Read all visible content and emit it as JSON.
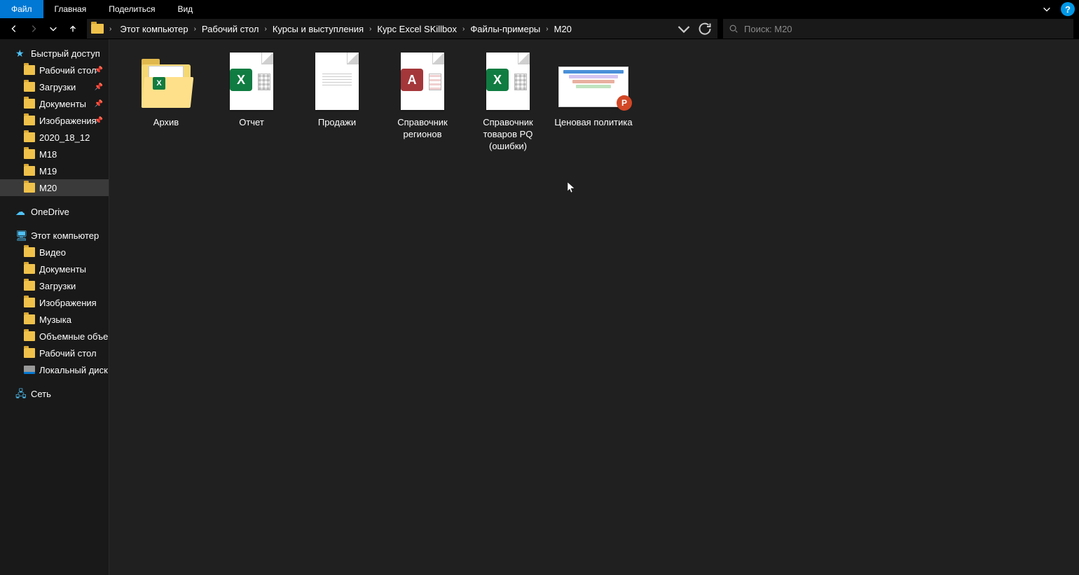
{
  "ribbon": {
    "tabs": [
      "Файл",
      "Главная",
      "Поделиться",
      "Вид"
    ],
    "active": 0,
    "help": "?"
  },
  "breadcrumb": [
    "Этот компьютер",
    "Рабочий стол",
    "Курсы и выступления",
    "Курс Excel SKillbox",
    "Файлы-примеры",
    "M20"
  ],
  "search_placeholder": "Поиск: M20",
  "sidebar": {
    "quick_access": "Быстрый доступ",
    "quick_items": [
      {
        "label": "Рабочий стол",
        "pinned": true
      },
      {
        "label": "Загрузки",
        "pinned": true
      },
      {
        "label": "Документы",
        "pinned": true
      },
      {
        "label": "Изображения",
        "pinned": true
      },
      {
        "label": "2020_18_12",
        "pinned": false
      },
      {
        "label": "M18",
        "pinned": false
      },
      {
        "label": "M19",
        "pinned": false
      },
      {
        "label": "M20",
        "pinned": false,
        "selected": true
      }
    ],
    "onedrive": "OneDrive",
    "this_pc": "Этот компьютер",
    "pc_items": [
      "Видео",
      "Документы",
      "Загрузки",
      "Изображения",
      "Музыка",
      "Объемные объекты",
      "Рабочий стол",
      "Локальный диск (C:"
    ],
    "network": "Сеть"
  },
  "files": [
    {
      "name": "Архив",
      "type": "folder-excel"
    },
    {
      "name": "Отчет",
      "type": "excel"
    },
    {
      "name": "Продажи",
      "type": "blank"
    },
    {
      "name": "Справочник регионов",
      "type": "access"
    },
    {
      "name": "Справочник товаров PQ (ошибки)",
      "type": "excel"
    },
    {
      "name": "Ценовая политика",
      "type": "ppt"
    }
  ]
}
